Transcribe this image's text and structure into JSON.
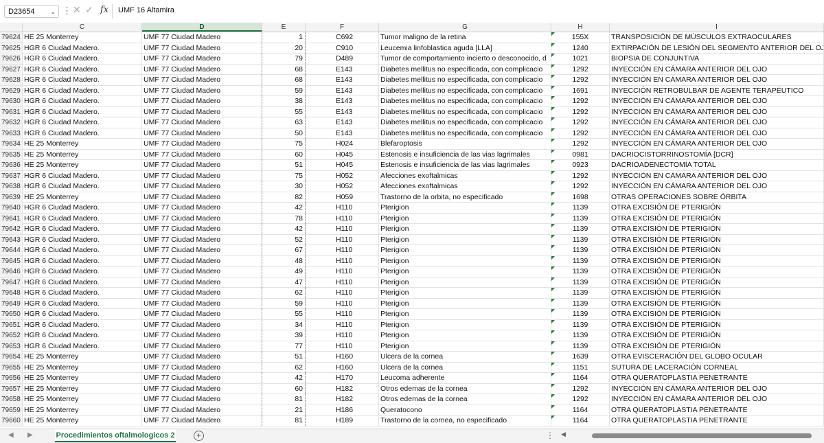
{
  "formula_bar": {
    "name_box": "D23654",
    "formula": "UMF 16 Altamira",
    "fx_label": "fx"
  },
  "columns": [
    "C",
    "D",
    "E",
    "F",
    "G",
    "H",
    "I"
  ],
  "rows": [
    {
      "row": "79624",
      "c": "HE 25 Monterrey",
      "d": "UMF 77 Ciudad Madero",
      "e": "1",
      "f": "C692",
      "g": "Tumor maligno de la retina",
      "h": "155X",
      "i": "TRANSPOSICIÓN DE MÚSCULOS EXTRAOCULARES"
    },
    {
      "row": "79625",
      "c": "HGR 6 Ciudad Madero.",
      "d": "UMF 77 Ciudad Madero",
      "e": "20",
      "f": "C910",
      "g": "Leucemia linfoblastica aguda [LLA]",
      "h": "1240",
      "i": "EXTIRPACIÓN DE LESIÓN DEL SEGMENTO ANTERIOR DEL OJO, NO E"
    },
    {
      "row": "79626",
      "c": "HGR 6 Ciudad Madero.",
      "d": "UMF 77 Ciudad Madero",
      "e": "79",
      "f": "D489",
      "g": "Tumor de comportamiento incierto o desconocido, d",
      "h": "1021",
      "i": "BIOPSIA DE CONJUNTIVA"
    },
    {
      "row": "79627",
      "c": "HGR 6 Ciudad Madero.",
      "d": "UMF 77 Ciudad Madero",
      "e": "68",
      "f": "E143",
      "g": "Diabetes mellitus no especificada, con complicacio",
      "h": "1292",
      "i": "INYECCIÓN EN CÁMARA ANTERIOR DEL OJO"
    },
    {
      "row": "79628",
      "c": "HGR 6 Ciudad Madero.",
      "d": "UMF 77 Ciudad Madero",
      "e": "68",
      "f": "E143",
      "g": "Diabetes mellitus no especificada, con complicacio",
      "h": "1292",
      "i": "INYECCIÓN EN CÁMARA ANTERIOR DEL OJO"
    },
    {
      "row": "79629",
      "c": "HGR 6 Ciudad Madero.",
      "d": "UMF 77 Ciudad Madero",
      "e": "59",
      "f": "E143",
      "g": "Diabetes mellitus no especificada, con complicacio",
      "h": "1691",
      "i": "INYECCIÓN RETROBULBAR DE AGENTE TERAPÉUTICO"
    },
    {
      "row": "79630",
      "c": "HGR 6 Ciudad Madero.",
      "d": "UMF 77 Ciudad Madero",
      "e": "38",
      "f": "E143",
      "g": "Diabetes mellitus no especificada, con complicacio",
      "h": "1292",
      "i": "INYECCIÓN EN CÁMARA ANTERIOR DEL OJO"
    },
    {
      "row": "79631",
      "c": "HGR 6 Ciudad Madero.",
      "d": "UMF 77 Ciudad Madero",
      "e": "55",
      "f": "E143",
      "g": "Diabetes mellitus no especificada, con complicacio",
      "h": "1292",
      "i": "INYECCIÓN EN CÁMARA ANTERIOR DEL OJO"
    },
    {
      "row": "79632",
      "c": "HGR 6 Ciudad Madero.",
      "d": "UMF 77 Ciudad Madero",
      "e": "63",
      "f": "E143",
      "g": "Diabetes mellitus no especificada, con complicacio",
      "h": "1292",
      "i": "INYECCIÓN EN CÁMARA ANTERIOR DEL OJO"
    },
    {
      "row": "79633",
      "c": "HGR 6 Ciudad Madero.",
      "d": "UMF 77 Ciudad Madero",
      "e": "50",
      "f": "E143",
      "g": "Diabetes mellitus no especificada, con complicacio",
      "h": "1292",
      "i": "INYECCIÓN EN CÁMARA ANTERIOR DEL OJO"
    },
    {
      "row": "79634",
      "c": "HE 25 Monterrey",
      "d": "UMF 77 Ciudad Madero",
      "e": "75",
      "f": "H024",
      "g": "Blefaroptosis",
      "h": "1292",
      "i": "INYECCIÓN EN CÁMARA ANTERIOR DEL OJO"
    },
    {
      "row": "79635",
      "c": "HE 25 Monterrey",
      "d": "UMF 77 Ciudad Madero",
      "e": "60",
      "f": "H045",
      "g": "Estenosis e insuficiencia de las vias lagrimales",
      "h": "0981",
      "i": "DACRIOCISTORRINOSTOMÍA [DCR]"
    },
    {
      "row": "79636",
      "c": "HE 25 Monterrey",
      "d": "UMF 77 Ciudad Madero",
      "e": "51",
      "f": "H045",
      "g": "Estenosis e insuficiencia de las vias lagrimales",
      "h": "0923",
      "i": "DACRIOADENECTOMÍA TOTAL"
    },
    {
      "row": "79637",
      "c": "HGR 6 Ciudad Madero.",
      "d": "UMF 77 Ciudad Madero",
      "e": "75",
      "f": "H052",
      "g": "Afecciones exoftalmicas",
      "h": "1292",
      "i": "INYECCIÓN EN CÁMARA ANTERIOR DEL OJO"
    },
    {
      "row": "79638",
      "c": "HGR 6 Ciudad Madero.",
      "d": "UMF 77 Ciudad Madero",
      "e": "30",
      "f": "H052",
      "g": "Afecciones exoftalmicas",
      "h": "1292",
      "i": "INYECCIÓN EN CÁMARA ANTERIOR DEL OJO"
    },
    {
      "row": "79639",
      "c": "HE 25 Monterrey",
      "d": "UMF 77 Ciudad Madero",
      "e": "82",
      "f": "H059",
      "g": "Trastorno de la orbita, no especificado",
      "h": "1698",
      "i": "OTRAS OPERACIONES SOBRE ÓRBITA"
    },
    {
      "row": "79640",
      "c": "HGR 6 Ciudad Madero.",
      "d": "UMF 77 Ciudad Madero",
      "e": "42",
      "f": "H110",
      "g": "Pterigion",
      "h": "1139",
      "i": "OTRA EXCISIÓN DE PTERIGIÓN"
    },
    {
      "row": "79641",
      "c": "HGR 6 Ciudad Madero.",
      "d": "UMF 77 Ciudad Madero",
      "e": "78",
      "f": "H110",
      "g": "Pterigion",
      "h": "1139",
      "i": "OTRA EXCISIÓN DE PTERIGIÓN"
    },
    {
      "row": "79642",
      "c": "HGR 6 Ciudad Madero.",
      "d": "UMF 77 Ciudad Madero",
      "e": "42",
      "f": "H110",
      "g": "Pterigion",
      "h": "1139",
      "i": "OTRA EXCISIÓN DE PTERIGIÓN"
    },
    {
      "row": "79643",
      "c": "HGR 6 Ciudad Madero.",
      "d": "UMF 77 Ciudad Madero",
      "e": "52",
      "f": "H110",
      "g": "Pterigion",
      "h": "1139",
      "i": "OTRA EXCISIÓN DE PTERIGIÓN"
    },
    {
      "row": "79644",
      "c": "HGR 6 Ciudad Madero.",
      "d": "UMF 77 Ciudad Madero",
      "e": "67",
      "f": "H110",
      "g": "Pterigion",
      "h": "1139",
      "i": "OTRA EXCISIÓN DE PTERIGIÓN"
    },
    {
      "row": "79645",
      "c": "HGR 6 Ciudad Madero.",
      "d": "UMF 77 Ciudad Madero",
      "e": "48",
      "f": "H110",
      "g": "Pterigion",
      "h": "1139",
      "i": "OTRA EXCISIÓN DE PTERIGIÓN"
    },
    {
      "row": "79646",
      "c": "HGR 6 Ciudad Madero.",
      "d": "UMF 77 Ciudad Madero",
      "e": "49",
      "f": "H110",
      "g": "Pterigion",
      "h": "1139",
      "i": "OTRA EXCISIÓN DE PTERIGIÓN"
    },
    {
      "row": "79647",
      "c": "HGR 6 Ciudad Madero.",
      "d": "UMF 77 Ciudad Madero",
      "e": "47",
      "f": "H110",
      "g": "Pterigion",
      "h": "1139",
      "i": "OTRA EXCISIÓN DE PTERIGIÓN"
    },
    {
      "row": "79648",
      "c": "HGR 6 Ciudad Madero.",
      "d": "UMF 77 Ciudad Madero",
      "e": "62",
      "f": "H110",
      "g": "Pterigion",
      "h": "1139",
      "i": "OTRA EXCISIÓN DE PTERIGIÓN"
    },
    {
      "row": "79649",
      "c": "HGR 6 Ciudad Madero.",
      "d": "UMF 77 Ciudad Madero",
      "e": "59",
      "f": "H110",
      "g": "Pterigion",
      "h": "1139",
      "i": "OTRA EXCISIÓN DE PTERIGIÓN"
    },
    {
      "row": "79650",
      "c": "HGR 6 Ciudad Madero.",
      "d": "UMF 77 Ciudad Madero",
      "e": "55",
      "f": "H110",
      "g": "Pterigion",
      "h": "1139",
      "i": "OTRA EXCISIÓN DE PTERIGIÓN"
    },
    {
      "row": "79651",
      "c": "HGR 6 Ciudad Madero.",
      "d": "UMF 77 Ciudad Madero",
      "e": "34",
      "f": "H110",
      "g": "Pterigion",
      "h": "1139",
      "i": "OTRA EXCISIÓN DE PTERIGIÓN"
    },
    {
      "row": "79652",
      "c": "HGR 6 Ciudad Madero.",
      "d": "UMF 77 Ciudad Madero",
      "e": "39",
      "f": "H110",
      "g": "Pterigion",
      "h": "1139",
      "i": "OTRA EXCISIÓN DE PTERIGIÓN"
    },
    {
      "row": "79653",
      "c": "HGR 6 Ciudad Madero.",
      "d": "UMF 77 Ciudad Madero",
      "e": "77",
      "f": "H110",
      "g": "Pterigion",
      "h": "1139",
      "i": "OTRA EXCISIÓN DE PTERIGIÓN"
    },
    {
      "row": "79654",
      "c": "HE 25 Monterrey",
      "d": "UMF 77 Ciudad Madero",
      "e": "51",
      "f": "H160",
      "g": "Ulcera de la cornea",
      "h": "1639",
      "i": "OTRA EVISCERACIÓN DEL GLOBO OCULAR"
    },
    {
      "row": "79655",
      "c": "HE 25 Monterrey",
      "d": "UMF 77 Ciudad Madero",
      "e": "62",
      "f": "H160",
      "g": "Ulcera de la cornea",
      "h": "1151",
      "i": "SUTURA DE LACERACIÓN CORNEAL"
    },
    {
      "row": "79656",
      "c": "HE 25 Monterrey",
      "d": "UMF 77 Ciudad Madero",
      "e": "42",
      "f": "H170",
      "g": "Leucoma adherente",
      "h": "1164",
      "i": "OTRA QUERATOPLASTIA PENETRANTE"
    },
    {
      "row": "79657",
      "c": "HE 25 Monterrey",
      "d": "UMF 77 Ciudad Madero",
      "e": "60",
      "f": "H182",
      "g": "Otros edemas de la cornea",
      "h": "1292",
      "i": "INYECCIÓN EN CÁMARA ANTERIOR DEL OJO"
    },
    {
      "row": "79658",
      "c": "HE 25 Monterrey",
      "d": "UMF 77 Ciudad Madero",
      "e": "81",
      "f": "H182",
      "g": "Otros edemas de la cornea",
      "h": "1292",
      "i": "INYECCIÓN EN CÁMARA ANTERIOR DEL OJO"
    },
    {
      "row": "79659",
      "c": "HE 25 Monterrey",
      "d": "UMF 77 Ciudad Madero",
      "e": "21",
      "f": "H186",
      "g": "Queratocono",
      "h": "1164",
      "i": "OTRA QUERATOPLASTIA PENETRANTE"
    },
    {
      "row": "79660",
      "c": "HE 25 Monterrey",
      "d": "UMF 77 Ciudad Madero",
      "e": "81",
      "f": "H189",
      "g": "Trastorno de la cornea, no especificado",
      "h": "1164",
      "i": "OTRA QUERATOPLASTIA PENETRANTE"
    }
  ],
  "sheet_tabs": {
    "active": "Procedimientos oftalmologicos 2"
  },
  "colors": {
    "accent": "#217346",
    "indicator": "#1e7a3a"
  }
}
